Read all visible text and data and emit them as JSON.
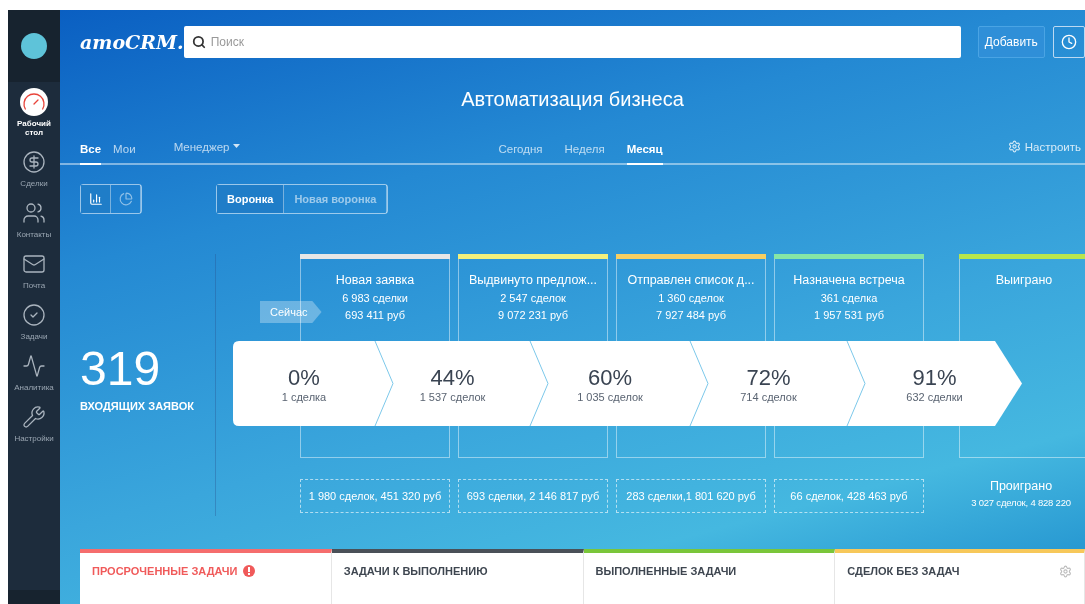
{
  "sidebar": {
    "items": [
      {
        "label": "Рабочий стол",
        "kind": "desk",
        "selected": true
      },
      {
        "label": "Сделки",
        "kind": "deals",
        "selected": false
      },
      {
        "label": "Контакты",
        "kind": "contacts",
        "selected": false
      },
      {
        "label": "Почта",
        "kind": "mail",
        "selected": false
      },
      {
        "label": "Задачи",
        "kind": "tasks",
        "selected": false
      },
      {
        "label": "Аналитика",
        "kind": "analytics",
        "selected": false
      },
      {
        "label": "Настройки",
        "kind": "settings",
        "selected": false
      }
    ]
  },
  "header": {
    "logo": "amoCRM.",
    "search": {
      "placeholder": "Поиск"
    },
    "add_button": "Добавить"
  },
  "title": "Автоматизация бизнеса",
  "filters": {
    "scope": [
      {
        "label": "Все",
        "selected": true
      },
      {
        "label": "Мои",
        "selected": false
      }
    ],
    "manager": "Менеджер",
    "periods": [
      {
        "label": "Сегодня",
        "selected": false
      },
      {
        "label": "Неделя",
        "selected": false
      },
      {
        "label": "Месяц",
        "selected": true
      }
    ],
    "settings": "Настроить"
  },
  "view_toggle": [
    {
      "kind": "bars",
      "selected": true
    },
    {
      "kind": "pie",
      "selected": false
    }
  ],
  "pipelines": [
    {
      "label": "Воронка",
      "selected": true
    },
    {
      "label": "Новая воронка",
      "selected": false
    }
  ],
  "incoming": {
    "count": "319",
    "label": "ВХОДЯЩИХ ЗАЯВОК"
  },
  "now_tag": "Сейчас",
  "stages": [
    {
      "name": "Новая заявка",
      "deals": "6 983 сделки",
      "amount": "693 411 руб",
      "color": "#e6e6e6",
      "summary": "1 980 сделок, 451 320 руб"
    },
    {
      "name": "Выдвинуто предлож...",
      "deals": "2 547 сделок",
      "amount": "9 072 231 руб",
      "color": "#f3f07c",
      "summary": "693 сделки, 2 146 817 руб"
    },
    {
      "name": "Отправлен список д...",
      "deals": "1 360 сделок",
      "amount": "7 927 484 руб",
      "color": "#f7cf62",
      "summary": "283 сделки,1 801 620 руб"
    },
    {
      "name": "Назначена встреча",
      "deals": "361 сделка",
      "amount": "1 957 531 руб",
      "color": "#86e6a6",
      "summary": "66 сделок, 428 463 руб"
    },
    {
      "name": "Выиграно",
      "color": "#b9e64c"
    }
  ],
  "lost": {
    "title": "Проиграно",
    "text": "3 027 сделок, 4 828 220"
  },
  "conversion": [
    {
      "percent": "0%",
      "deals": "1 сделка"
    },
    {
      "percent": "44%",
      "deals": "1 537 сделок"
    },
    {
      "percent": "60%",
      "deals": "1 035 сделок"
    },
    {
      "percent": "72%",
      "deals": "714 сделок"
    },
    {
      "percent": "91%",
      "deals": "632 сделки"
    }
  ],
  "tasks": [
    {
      "label": "ПРОСРОЧЕННЫЕ ЗАДАЧИ",
      "kind": "alert",
      "color": "#f56d6d"
    },
    {
      "label": "ЗАДАЧИ К ВЫПОЛНЕНИЮ",
      "kind": "plain",
      "color": "#4a5058"
    },
    {
      "label": "ВЫПОЛНЕННЫЕ ЗАДАЧИ",
      "kind": "plain",
      "color": "#7ac63a"
    },
    {
      "label": "СДЕЛОК БЕЗ ЗАДАЧ",
      "kind": "settings",
      "color": "#f7c85a"
    }
  ]
}
